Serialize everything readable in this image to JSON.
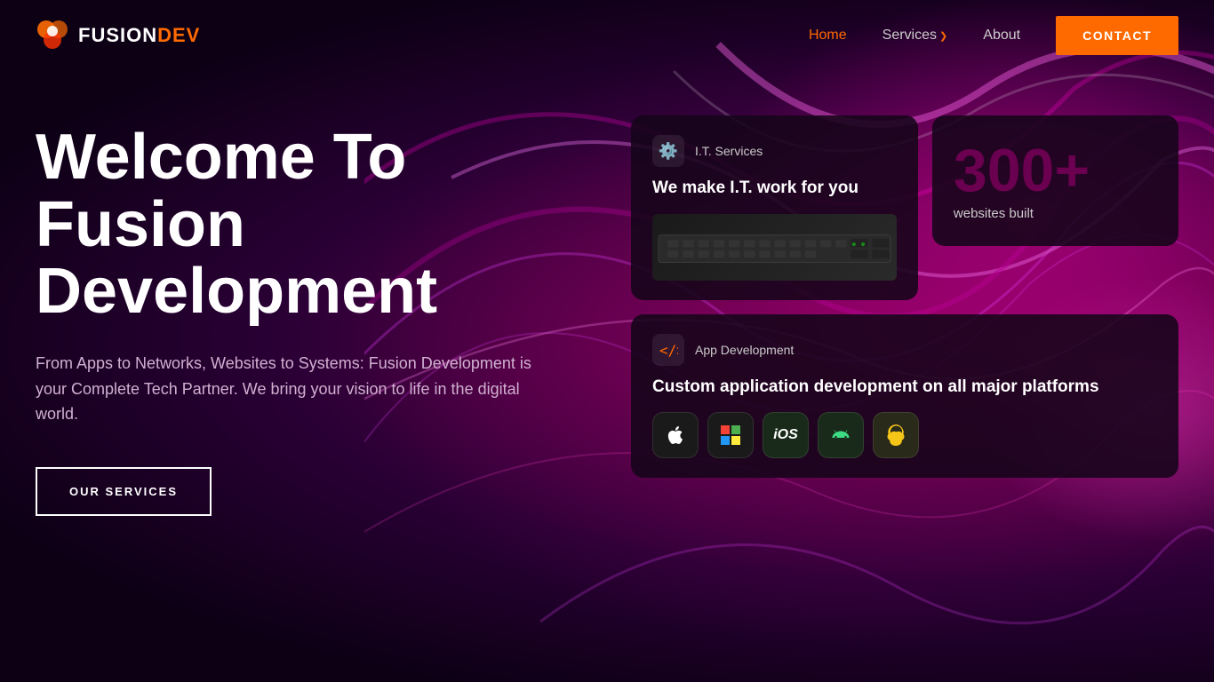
{
  "brand": {
    "name_fusion": "FUSION",
    "name_dev": "DEV"
  },
  "nav": {
    "home_label": "Home",
    "services_label": "Services",
    "about_label": "About",
    "contact_label": "CONTACT"
  },
  "hero": {
    "title": "Welcome To Fusion Development",
    "subtitle": "From Apps to Networks, Websites to Systems: Fusion Development is your Complete Tech Partner. We bring your vision to life in the digital world.",
    "cta_label": "OUR SERVICES"
  },
  "card_it": {
    "tag": "I.T. Services",
    "title": "We make I.T. work for you"
  },
  "card_stat": {
    "number": "300",
    "plus": "+",
    "label": "websites built"
  },
  "card_app": {
    "tag": "App Development",
    "title": "Custom application development on all major platforms"
  },
  "platforms": [
    {
      "name": "Apple",
      "type": "apple"
    },
    {
      "name": "Windows",
      "type": "windows"
    },
    {
      "name": "iOS",
      "type": "ios"
    },
    {
      "name": "Android",
      "type": "android"
    },
    {
      "name": "Linux",
      "type": "linux"
    }
  ]
}
